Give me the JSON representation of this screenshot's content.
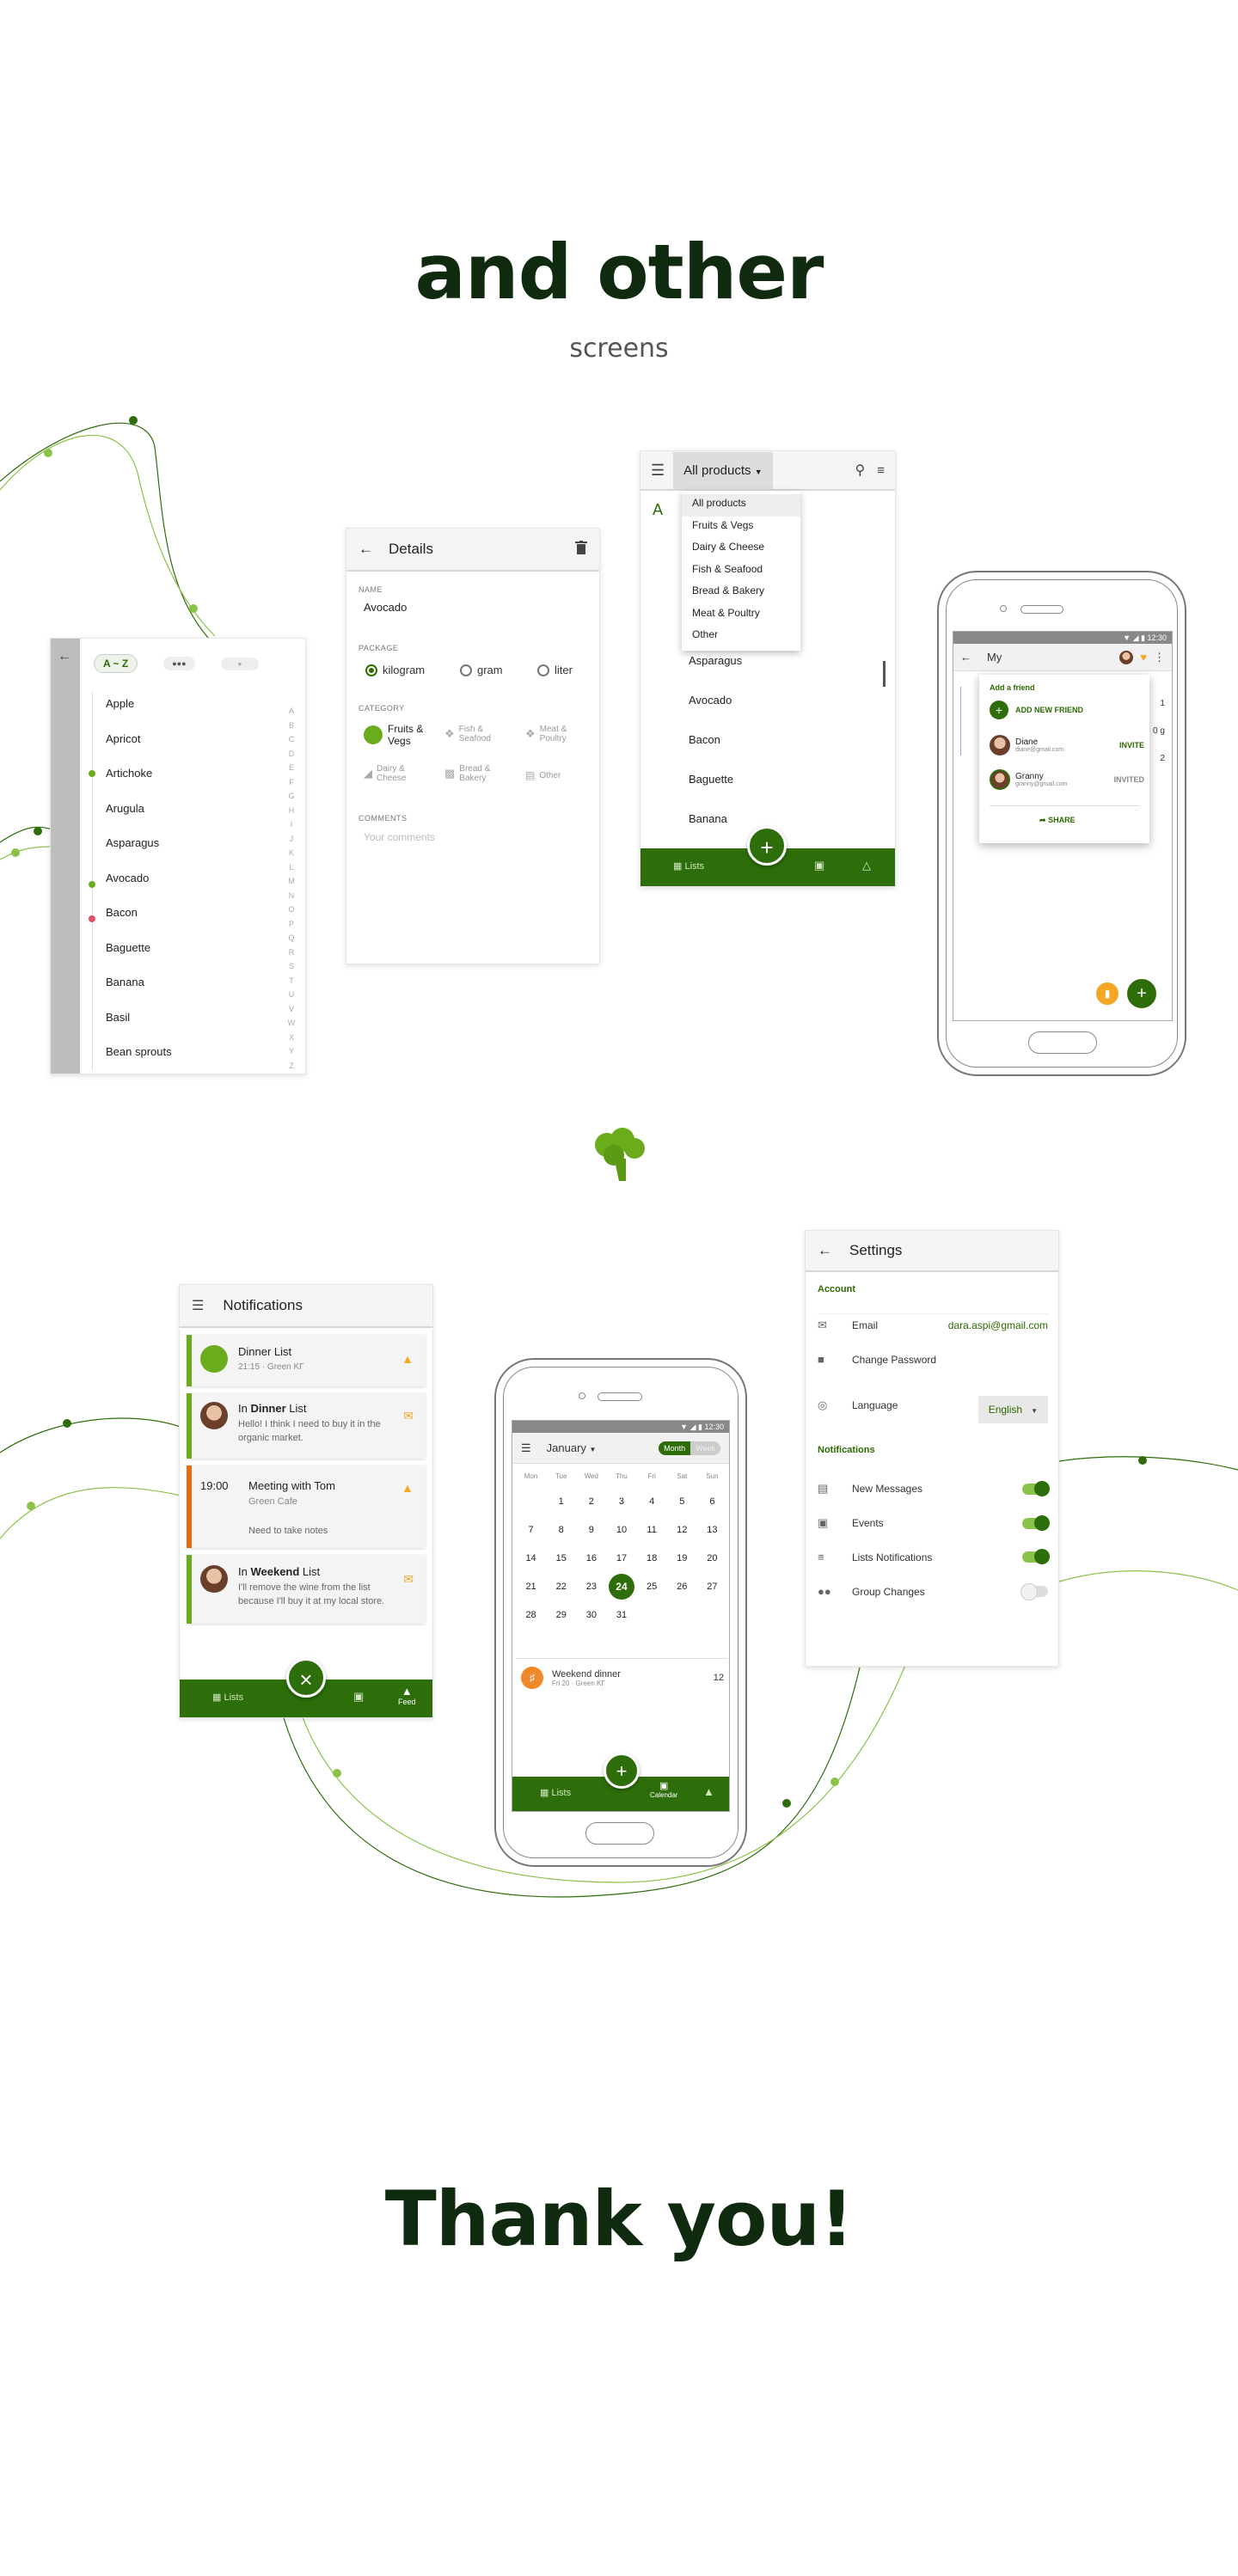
{
  "headings": {
    "title": "and other",
    "subtitle": "screens",
    "thanks": "Thank you!"
  },
  "colors": {
    "brand_green": "#2d6e0a",
    "accent_light_green": "#8bc34a",
    "orange": "#f5a623",
    "heading": "#0f2a0f"
  },
  "az_list": {
    "chips": [
      "A ~ Z",
      "●●●",
      "●"
    ],
    "items": [
      "Apple",
      "Apricot",
      "Artichoke",
      "Arugula",
      "Asparagus",
      "Avocado",
      "Bacon",
      "Baguette",
      "Banana",
      "Basil",
      "Bean sprouts"
    ],
    "index": [
      "A",
      "B",
      "C",
      "D",
      "E",
      "F",
      "G",
      "H",
      "I",
      "J",
      "K",
      "L",
      "M",
      "N",
      "O",
      "P",
      "Q",
      "R",
      "S",
      "T",
      "U",
      "V",
      "W",
      "X",
      "Y",
      "Z"
    ]
  },
  "details": {
    "title": "Details",
    "name_label": "Name",
    "name_value": "Avocado",
    "package_label": "Package",
    "package_options": [
      "kilogram",
      "gram",
      "liter"
    ],
    "category_label": "Category",
    "categories": [
      "Fruits & Vegs",
      "Fish & Seafood",
      "Meat & Poultry",
      "Dairy & Cheese",
      "Bread & Bakery",
      "Other"
    ],
    "comments_label": "Comments",
    "comments_placeholder": "Your comments"
  },
  "products": {
    "dropdown_selected": "All products",
    "letter": "A",
    "menu": [
      "All products",
      "Fruits & Vegs",
      "Dairy & Cheese",
      "Fish & Seafood",
      "Bread & Bakery",
      "Meat & Poultry",
      "Other"
    ],
    "items": [
      "Asparagus",
      "Avocado",
      "Bacon",
      "Baguette",
      "Banana"
    ],
    "nav_lists": "Lists"
  },
  "friends_phone": {
    "time": "12:30",
    "title": "My",
    "popup_title": "Add a friend",
    "add_new": "ADD NEW FRIEND",
    "friends": [
      {
        "name": "Diane",
        "email": "diane@gmail.com",
        "action": "INVITE"
      },
      {
        "name": "Granny",
        "email": "granny@gmail.com",
        "action": "INVITED"
      }
    ],
    "share": "SHARE",
    "right_numbers": [
      "1",
      "0 g",
      "2"
    ]
  },
  "notifications": {
    "title": "Notifications",
    "items": [
      {
        "prefix": "",
        "bold": "",
        "title": "Dinner List",
        "line1": "21:15 · Green KГ",
        "line2": ""
      },
      {
        "prefix": "In ",
        "bold": "Dinner",
        "title": " List",
        "line1": "Hello! I think I need to buy it in the",
        "line2": "organic market."
      },
      {
        "prefix": "",
        "bold": "",
        "title": "Meeting with Tom",
        "time": "19:00",
        "line1": "Green Cafe",
        "line2": "Need to take notes"
      },
      {
        "prefix": "In ",
        "bold": "Weekend",
        "title": " List",
        "line1": "I'll remove the wine from the list",
        "line2": "because I'll buy it at my local store."
      }
    ],
    "nav_lists": "Lists",
    "nav_feed": "Feed"
  },
  "calendar": {
    "time": "12:30",
    "month": "January",
    "toggle": [
      "Month",
      "Week"
    ],
    "weekdays": [
      "Mon",
      "Tue",
      "Wed",
      "Thu",
      "Fri",
      "Sat",
      "Sun"
    ],
    "weeks": [
      [
        "",
        "1",
        "2",
        "3",
        "4",
        "5",
        "6"
      ],
      [
        "7",
        "8",
        "9",
        "10",
        "11",
        "12",
        "13"
      ],
      [
        "14",
        "15",
        "16",
        "17",
        "18",
        "19",
        "20"
      ],
      [
        "21",
        "22",
        "23",
        "24",
        "25",
        "26",
        "27"
      ],
      [
        "28",
        "29",
        "30",
        "31",
        "",
        "",
        ""
      ]
    ],
    "selected_day": "24",
    "event": {
      "title": "Weekend dinner",
      "sub": "Fri 20 · Green KГ",
      "count": "12"
    },
    "nav_lists": "Lists",
    "nav_calendar": "Calendar"
  },
  "settings": {
    "title": "Settings",
    "account_header": "Account",
    "email_label": "Email",
    "email_value": "dara.aspi@gmail.com",
    "password_label": "Change Password",
    "language_label": "Language",
    "language_value": "English",
    "notifications_header": "Notifications",
    "toggles": [
      {
        "label": "New Messages",
        "on": true
      },
      {
        "label": "Events",
        "on": true
      },
      {
        "label": "Lists Notifications",
        "on": true
      },
      {
        "label": "Group Changes",
        "on": false
      }
    ]
  }
}
